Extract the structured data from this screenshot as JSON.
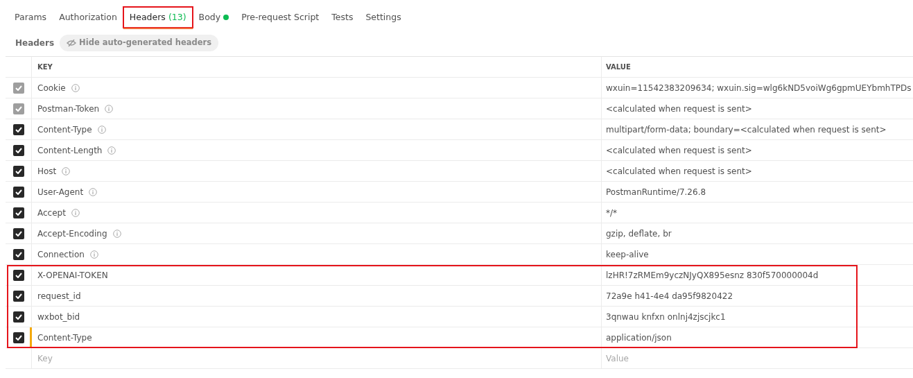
{
  "tabs": [
    {
      "label": "Params",
      "selected": false
    },
    {
      "label": "Authorization",
      "selected": false
    },
    {
      "label": "Headers",
      "count": "(13)",
      "selected": true,
      "annotated": true
    },
    {
      "label": "Body",
      "dot": true,
      "selected": false
    },
    {
      "label": "Pre-request Script",
      "selected": false
    },
    {
      "label": "Tests",
      "selected": false
    },
    {
      "label": "Settings",
      "selected": false
    }
  ],
  "toolbar": {
    "title": "Headers",
    "toggle": "Hide auto-generated headers"
  },
  "table": {
    "columns": [
      "KEY",
      "VALUE"
    ],
    "rows": [
      {
        "key": "Cookie",
        "value": "wxuin=11542383209634; wxuin.sig=wlg6kND5voiWg6gpmUEYbmhTPDs",
        "checked": true,
        "disabled": true,
        "info": true,
        "annotated": false,
        "edited": false
      },
      {
        "key": "Postman-Token",
        "value": "<calculated when request is sent>",
        "checked": true,
        "disabled": true,
        "info": true,
        "annotated": false,
        "edited": false
      },
      {
        "key": "Content-Type",
        "value": "multipart/form-data; boundary=<calculated when request is sent>",
        "checked": true,
        "disabled": false,
        "info": true,
        "annotated": false,
        "edited": false
      },
      {
        "key": "Content-Length",
        "value": "<calculated when request is sent>",
        "checked": true,
        "disabled": false,
        "info": true,
        "annotated": false,
        "edited": false
      },
      {
        "key": "Host",
        "value": "<calculated when request is sent>",
        "checked": true,
        "disabled": false,
        "info": true,
        "annotated": false,
        "edited": false
      },
      {
        "key": "User-Agent",
        "value": "PostmanRuntime/7.26.8",
        "checked": true,
        "disabled": false,
        "info": true,
        "annotated": false,
        "edited": false
      },
      {
        "key": "Accept",
        "value": "*/*",
        "checked": true,
        "disabled": false,
        "info": true,
        "annotated": false,
        "edited": false
      },
      {
        "key": "Accept-Encoding",
        "value": "gzip, deflate, br",
        "checked": true,
        "disabled": false,
        "info": true,
        "annotated": false,
        "edited": false
      },
      {
        "key": "Connection",
        "value": "keep-alive",
        "checked": true,
        "disabled": false,
        "info": true,
        "annotated": false,
        "edited": false
      },
      {
        "key": "X-OPENAI-TOKEN",
        "value": "lzHR!7zRMEm9yczNJyQX895esnz 830f570000004d",
        "checked": true,
        "disabled": false,
        "info": false,
        "annotated": true,
        "edited": false
      },
      {
        "key": "request_id",
        "value": "72a9e h41-4e4 da95f9820422",
        "checked": true,
        "disabled": false,
        "info": false,
        "annotated": true,
        "edited": false
      },
      {
        "key": "wxbot_bid",
        "value": "3qnwau knfxn onlnj4zjscjkc1",
        "checked": true,
        "disabled": false,
        "info": false,
        "annotated": true,
        "edited": false
      },
      {
        "key": "Content-Type",
        "value": "application/json",
        "checked": true,
        "disabled": false,
        "info": false,
        "annotated": true,
        "edited": true
      }
    ],
    "new_row": {
      "key_placeholder": "Key",
      "value_placeholder": "Value"
    }
  }
}
